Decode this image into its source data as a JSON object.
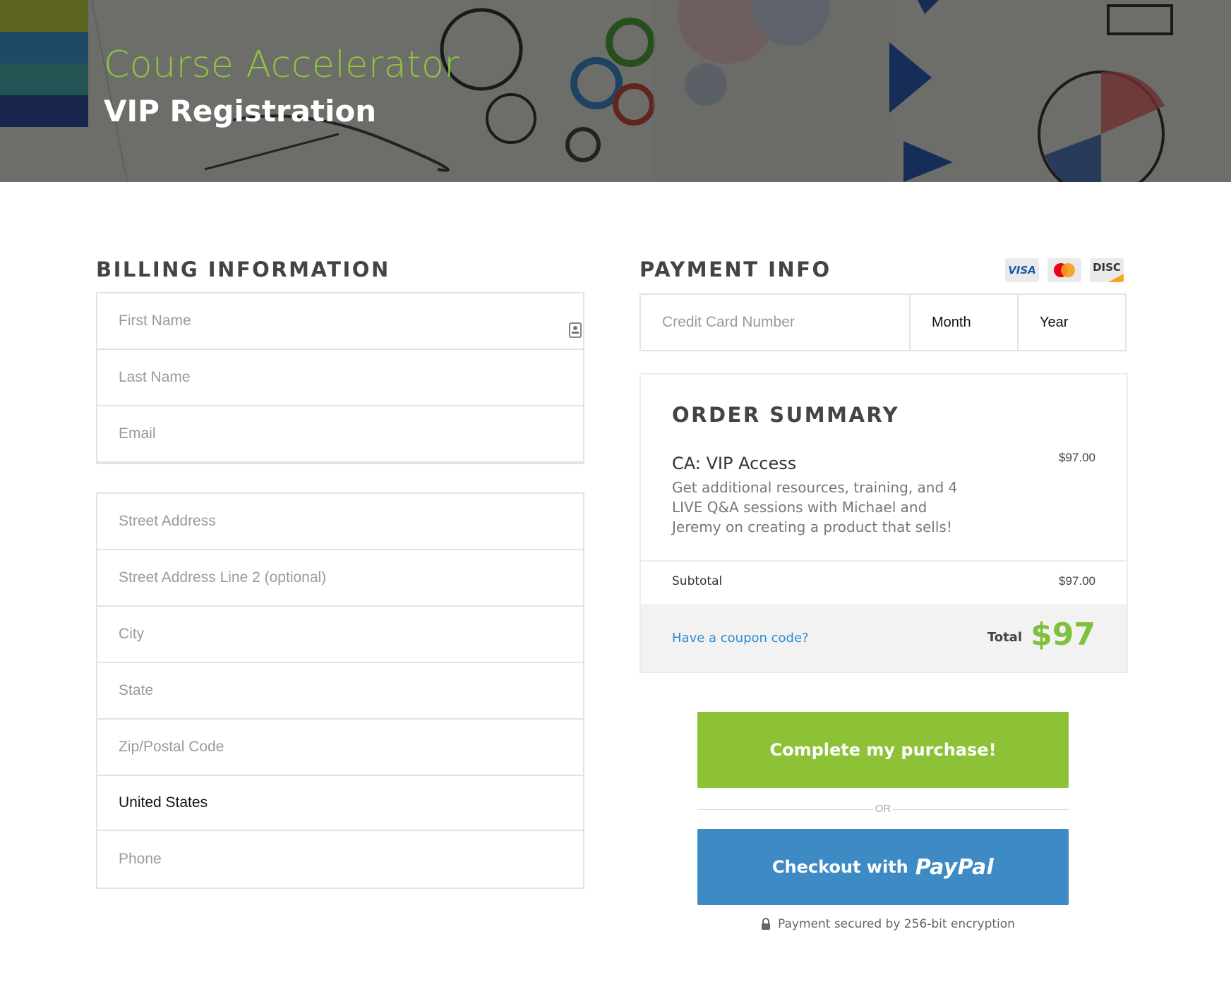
{
  "hero": {
    "title": "Course Accelerator",
    "subtitle": "VIP Registration"
  },
  "billing": {
    "heading": "BILLING INFORMATION",
    "contact_fields": [
      {
        "placeholder": "First Name"
      },
      {
        "placeholder": "Last Name"
      },
      {
        "placeholder": "Email"
      }
    ],
    "address_fields": [
      {
        "placeholder": "Street Address"
      },
      {
        "placeholder": "Street Address Line 2 (optional)"
      },
      {
        "placeholder": "City"
      },
      {
        "placeholder": "State"
      },
      {
        "placeholder": "Zip/Postal Code"
      }
    ],
    "country": "United States",
    "phone_placeholder": "Phone"
  },
  "payment": {
    "heading": "PAYMENT INFO",
    "card_icons": [
      {
        "icon": "visa-icon",
        "label": "VISA"
      },
      {
        "icon": "mastercard-icon",
        "label": ""
      },
      {
        "icon": "discover-icon",
        "label": "DISC"
      }
    ],
    "card_number_placeholder": "Credit Card Number",
    "month_label": "Month",
    "year_label": "Year"
  },
  "order_summary": {
    "heading": "ORDER SUMMARY",
    "item": {
      "name": "CA: VIP Access",
      "price": "$97.00",
      "description": "Get additional resources, training, and 4 LIVE Q&A sessions with Michael and Jeremy on creating a product that sells!"
    },
    "subtotal_label": "Subtotal",
    "subtotal_value": "$97.00",
    "coupon_link": "Have a coupon code?",
    "total_label": "Total",
    "total_value": "$97"
  },
  "actions": {
    "complete_label": "Complete my purchase!",
    "or_label": "OR",
    "paypal_prefix": "Checkout with",
    "paypal_brand": "PayPal",
    "secure_text": "Payment secured by 256-bit encryption"
  },
  "colors": {
    "accent_green": "#8dc236",
    "paypal_blue": "#3d8ac5",
    "link_blue": "#2a8dd4",
    "total_green": "#7dc13c"
  }
}
